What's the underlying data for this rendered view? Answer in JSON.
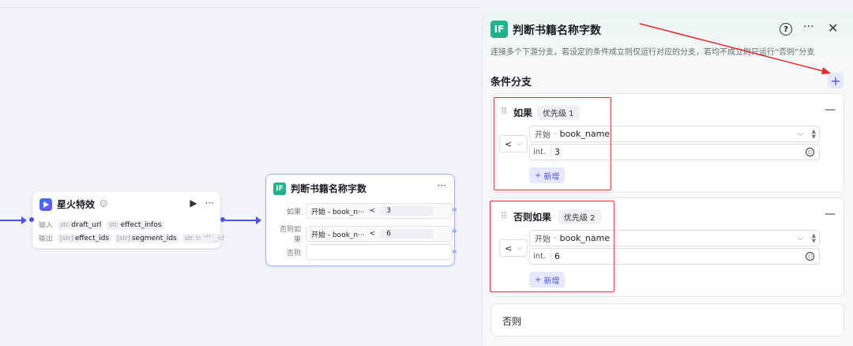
{
  "node_spark": {
    "title": "星火特效",
    "badge": "☺",
    "run_icon": "▶",
    "more_icon": "···",
    "input_label": "输入",
    "output_label": "输出",
    "inputs": [
      {
        "type": "str.",
        "name": "draft_url"
      },
      {
        "type": "str.",
        "name": "effect_infos"
      }
    ],
    "outputs": [
      {
        "type": "[str]",
        "name": "effect_ids"
      },
      {
        "type": "[str]",
        "name": "segment_ids"
      },
      {
        "type": "str.",
        "name": "track_id"
      }
    ],
    "outputs_more": "···"
  },
  "node_if": {
    "icon": "IF",
    "title": "判断书籍名称字数",
    "more_icon": "···",
    "rows": [
      {
        "label": "如果",
        "left": "开始 - book_n···",
        "op": "<",
        "right": "3"
      },
      {
        "label": "否则如果",
        "left": "开始 - book_n···",
        "op": "<",
        "right": "6"
      },
      {
        "label": "否则",
        "left": "",
        "op": "",
        "right": ""
      }
    ]
  },
  "panel": {
    "icon": "IF",
    "title": "判断书籍名称字数",
    "help_icon": "?",
    "more_icon": "···",
    "close_icon": "✕",
    "description": "连接多个下游分支，若设定的条件成立则仅运行对应的分支，若均不成立则只运行“否则”分支",
    "section_title": "条件分支",
    "add_icon": "+",
    "branches": [
      {
        "label": "如果",
        "priority": "优先级 1",
        "operator": "<",
        "left_source": "开始",
        "left_var": "book_name",
        "value_type": "int.",
        "value": "3",
        "add_label": "新增",
        "remove_icon": "—"
      },
      {
        "label": "否则如果",
        "priority": "优先级 2",
        "operator": "<",
        "left_source": "开始",
        "left_var": "book_name",
        "value_type": "int.",
        "value": "6",
        "add_label": "新增",
        "remove_icon": "—"
      }
    ],
    "else_label": "否则"
  },
  "colors": {
    "accent": "#4d53e8",
    "if_green": "#1fb28b",
    "annotation_red": "#e02b2b"
  }
}
